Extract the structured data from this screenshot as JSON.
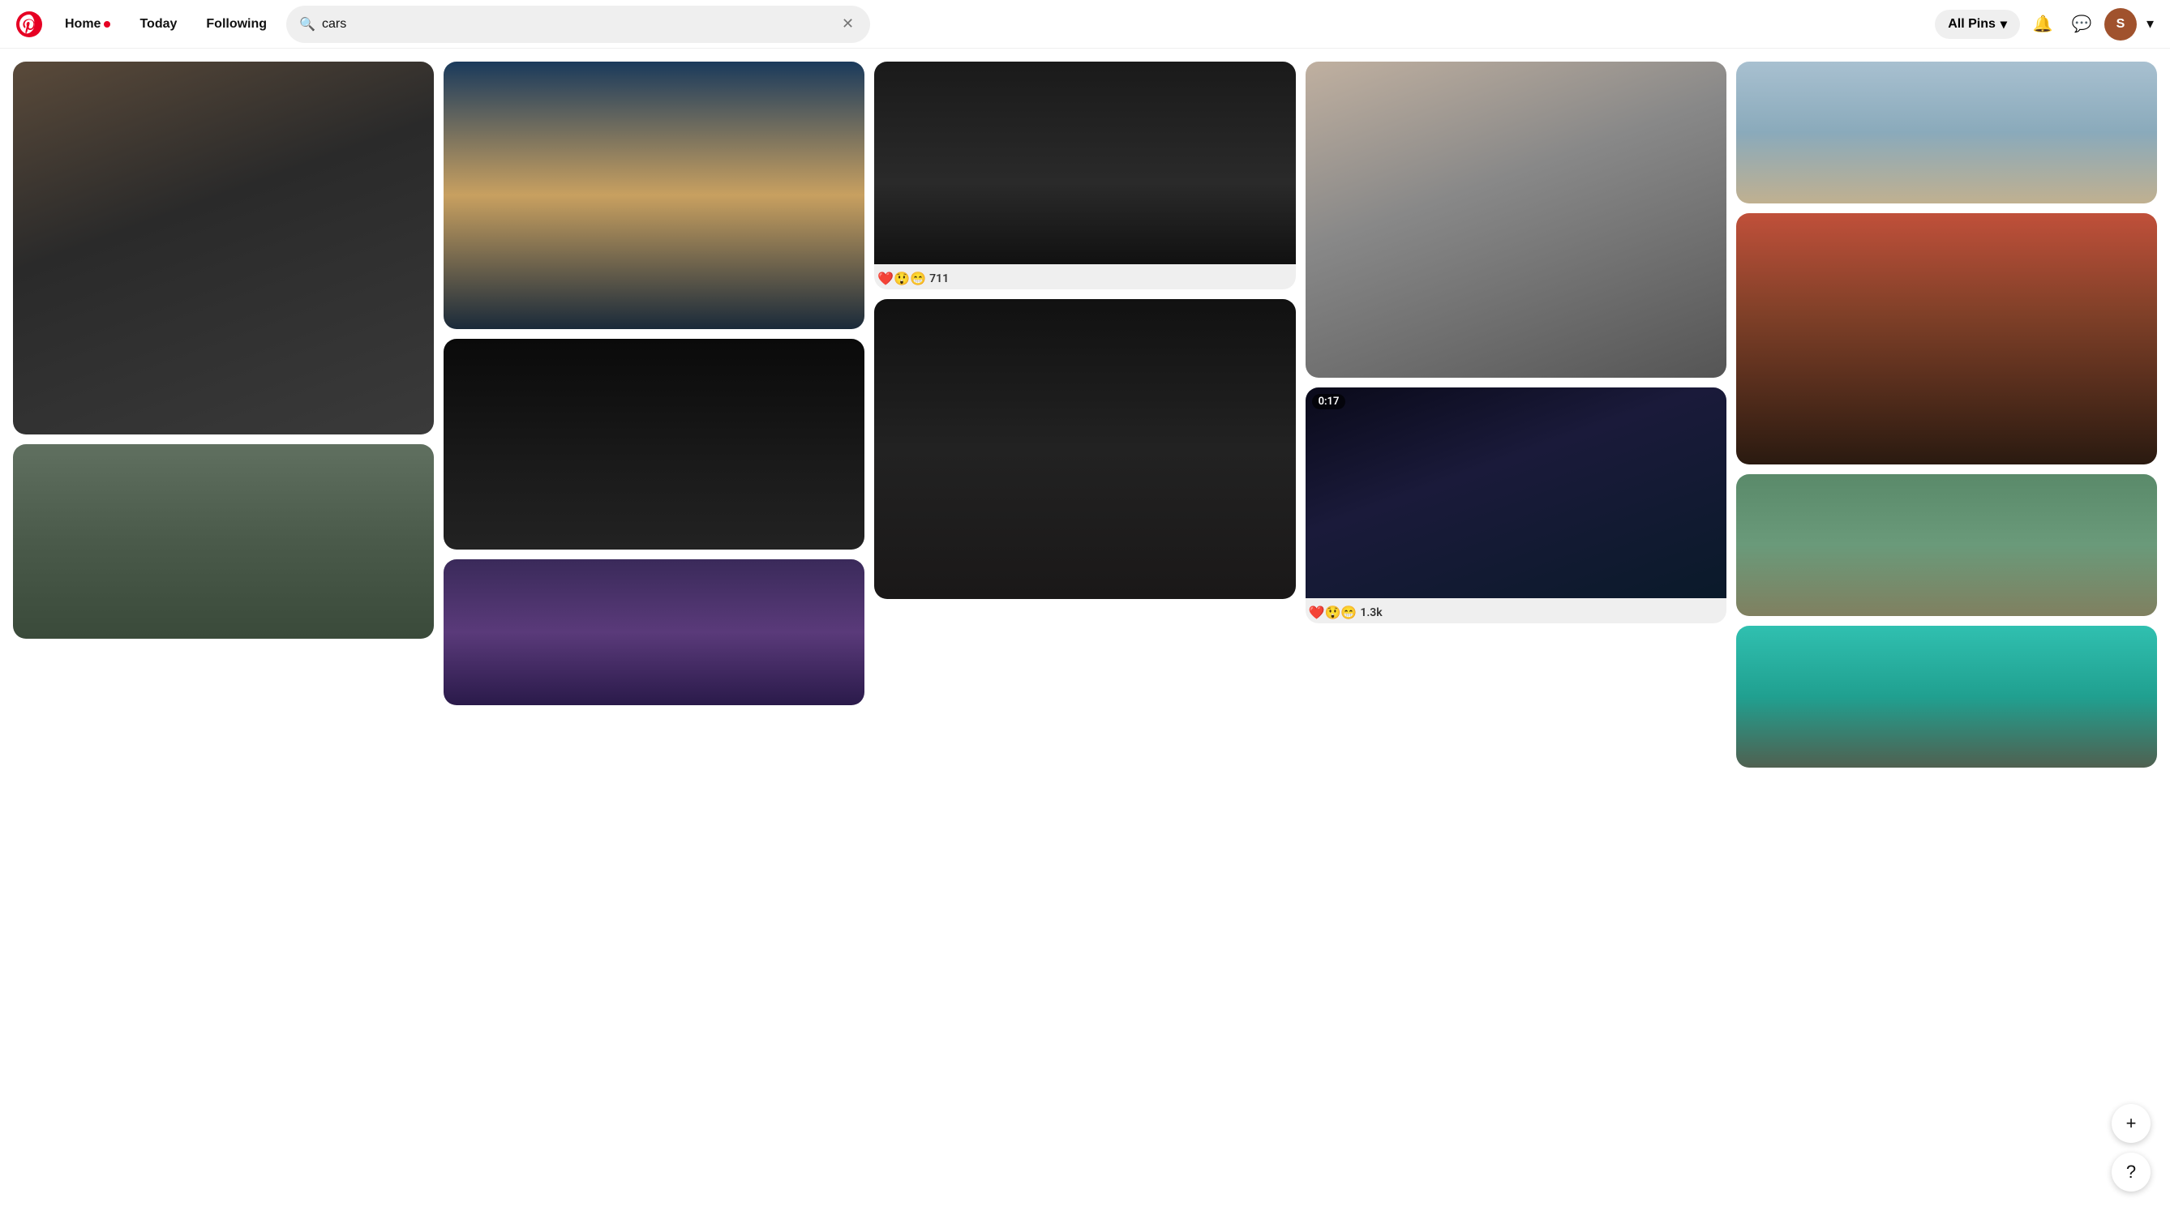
{
  "header": {
    "logo_alt": "Pinterest",
    "nav": {
      "home_label": "Home",
      "home_dot": true,
      "today_label": "Today",
      "following_label": "Following"
    },
    "search": {
      "value": "cars",
      "placeholder": "Search",
      "clear_label": "×"
    },
    "filter": {
      "label": "All Pins",
      "chevron": "▾"
    },
    "icons": {
      "bell": "🔔",
      "chat": "💬",
      "avatar_letter": "S",
      "expand": "▾"
    }
  },
  "pins": [
    {
      "id": "lamborghini",
      "img_class": "img-lamborghini",
      "reactions": null,
      "video": null
    },
    {
      "id": "audi",
      "img_class": "img-audi",
      "reactions": null,
      "video": null
    },
    {
      "id": "rolls",
      "img_class": "img-rolls",
      "reactions": {
        "emojis": "❤️😲😁",
        "count": "711"
      },
      "video": null
    },
    {
      "id": "ferrari",
      "img_class": "img-ferrari",
      "reactions": null,
      "video": null
    },
    {
      "id": "porsche",
      "img_class": "img-porsche",
      "reactions": null,
      "video": null
    },
    {
      "id": "rangerover",
      "img_class": "img-rangerover",
      "reactions": null,
      "video": null
    },
    {
      "id": "mercedes-top",
      "img_class": "img-mercedes-top",
      "reactions": null,
      "video": null
    },
    {
      "id": "futuristic",
      "img_class": "img-futuristic",
      "reactions": {
        "emojis": "❤️😲😁",
        "count": "1.3k"
      },
      "video": "0:17"
    },
    {
      "id": "sunset-jeep",
      "img_class": "img-sunset-jeep",
      "reactions": null,
      "video": null
    },
    {
      "id": "classic-blue",
      "img_class": "img-classic-blue",
      "reactions": null,
      "video": null
    },
    {
      "id": "jeep-grey",
      "img_class": "img-jeep-grey",
      "reactions": null,
      "video": null
    },
    {
      "id": "purple-sky",
      "img_class": "img-purple-sky",
      "reactions": null,
      "video": null
    },
    {
      "id": "bronco",
      "img_class": "img-bronco",
      "reactions": null,
      "video": null
    }
  ],
  "fab": {
    "plus_label": "+",
    "help_label": "?"
  }
}
